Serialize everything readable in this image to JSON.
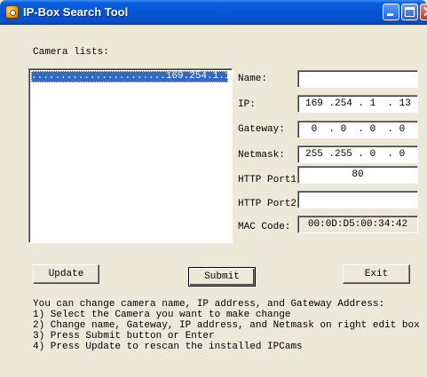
{
  "window": {
    "title": "IP-Box Search Tool"
  },
  "camera_list": {
    "label": "Camera lists:",
    "items": [
      ".......................169.254.1.13"
    ]
  },
  "form": {
    "name": {
      "label": "Name:",
      "value": ""
    },
    "ip": {
      "label": "IP:",
      "value": "169 .254 . 1  . 13"
    },
    "gateway": {
      "label": "Gateway:",
      "value": " 0  . 0  . 0  . 0"
    },
    "netmask": {
      "label": "Netmask:",
      "value": "255 .255 . 0  . 0"
    },
    "http_port1": {
      "label": "HTTP Port1",
      "value": "80"
    },
    "http_port2": {
      "label": "HTTP Port2",
      "value": ""
    },
    "mac": {
      "label": "MAC Code:",
      "value": "00:0D:D5:00:34:42"
    }
  },
  "buttons": {
    "update": "Update",
    "submit": "Submit",
    "exit": "Exit"
  },
  "instructions": [
    "You can change camera name, IP address, and Gateway Address:",
    "1) Select the Camera you want to make change",
    "2) Change name, Gateway, IP address, and Netmask on right edit box",
    "3) Press Submit button or Enter",
    "4) Press Update to rescan the installed IPCams"
  ],
  "icons": {
    "app": "app-icon",
    "minimize": "minimize-icon",
    "maximize": "maximize-icon",
    "close": "close-icon"
  }
}
